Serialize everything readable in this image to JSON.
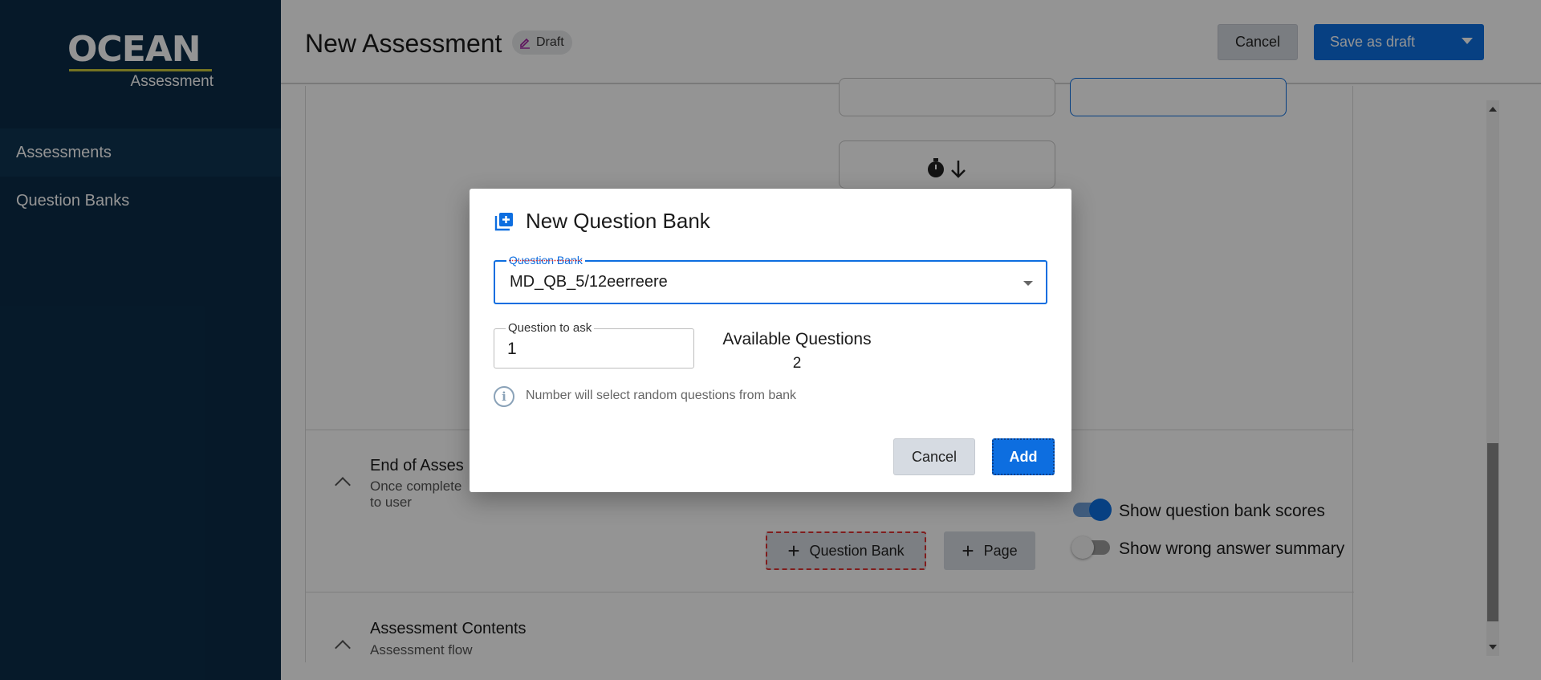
{
  "app": {
    "logo_main": "OCEAN",
    "logo_sub": "Assessment"
  },
  "sidebar": {
    "items": [
      {
        "label": "Assessments",
        "active": true
      },
      {
        "label": "Question Banks",
        "active": false
      }
    ]
  },
  "header": {
    "title": "New Assessment",
    "status_badge": "Draft",
    "cancel_label": "Cancel",
    "save_label": "Save as draft"
  },
  "sections": {
    "end_of_assessment": {
      "title": "End of Asses",
      "subtitle_line1": "Once complete",
      "subtitle_line2": "to user",
      "toggles": [
        {
          "label": "Show question bank scores",
          "on": true
        },
        {
          "label": "Show wrong answer summary",
          "on": false
        }
      ]
    },
    "assessment_contents": {
      "title": "Assessment Contents",
      "subtitle": "Assessment flow",
      "add_question_bank_label": "Question Bank",
      "add_page_label": "Page"
    }
  },
  "dialog": {
    "title": "New Question Bank",
    "question_bank": {
      "label": "Question Bank",
      "value": "MD_QB_5/12eerreere"
    },
    "question_to_ask": {
      "label": "Question to ask",
      "value": "1"
    },
    "available": {
      "label": "Available Questions",
      "count": "2"
    },
    "info_text": "Number will select random questions from bank",
    "cancel_label": "Cancel",
    "add_label": "Add"
  },
  "colors": {
    "sidebar_bg": "#0b2c48",
    "primary": "#0d6ee0",
    "logo_accent": "#c9c63a"
  }
}
